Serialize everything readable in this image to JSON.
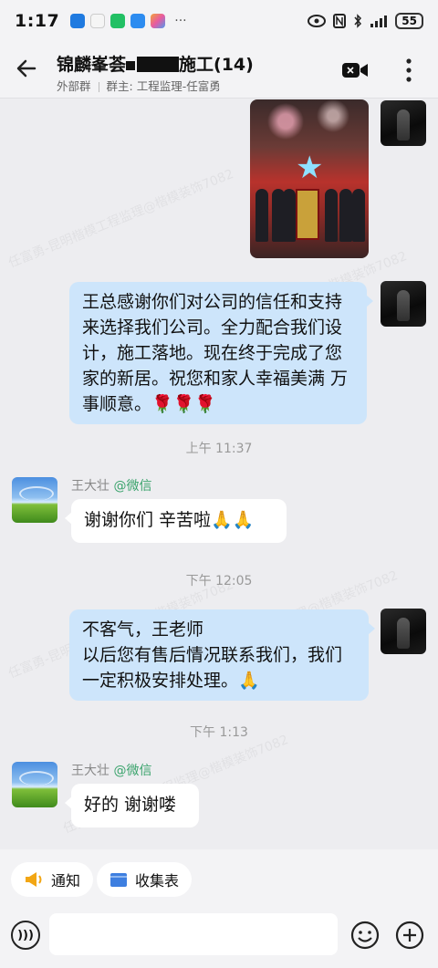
{
  "status_bar": {
    "time": "1:17",
    "battery": "55"
  },
  "header": {
    "title_prefix": "锦麟峯荟",
    "title_suffix": "施工",
    "member_count": "(14)",
    "group_type": "外部群",
    "owner": "群主: 工程监理-任富勇"
  },
  "messages": [
    {
      "id": "m1",
      "side": "right",
      "type": "image"
    },
    {
      "id": "m2",
      "side": "right",
      "type": "text",
      "text": "王总感谢你们对公司的信任和支持来选择我们公司。全力配合我们设计，施工落地。现在终于完成了您家的新居。祝您和家人幸福美满   万事顺意。🌹🌹🌹"
    },
    {
      "id": "t1",
      "type": "time",
      "text": "上午 11:37"
    },
    {
      "id": "m3",
      "side": "left",
      "type": "text",
      "sender": "王大壮",
      "sender_tag": "@微信",
      "text": "谢谢你们 辛苦啦🙏🙏"
    },
    {
      "id": "t2",
      "type": "time",
      "text": "下午 12:05"
    },
    {
      "id": "m4",
      "side": "right",
      "type": "text",
      "text_lines": [
        "不客气，王老师",
        "以后您有售后情况联系我们，我们一定积极安排处理。🙏"
      ]
    },
    {
      "id": "t3",
      "type": "time",
      "text": "下午 1:13"
    },
    {
      "id": "m5",
      "side": "left",
      "type": "text",
      "sender": "王大壮",
      "sender_tag": "@微信",
      "text": "好的 谢谢喽"
    }
  ],
  "watermark_text": "任富勇-昆明楷模工程监理@楷模装饰7082",
  "quick_actions": [
    {
      "label": "通知",
      "icon": "megaphone-icon"
    },
    {
      "label": "收集表",
      "icon": "folder-icon"
    }
  ],
  "colors": {
    "my_bubble": "#cde5fb",
    "other_bubble": "#ffffff",
    "background": "#ededf0",
    "wechat_tag": "#3aa36c"
  }
}
